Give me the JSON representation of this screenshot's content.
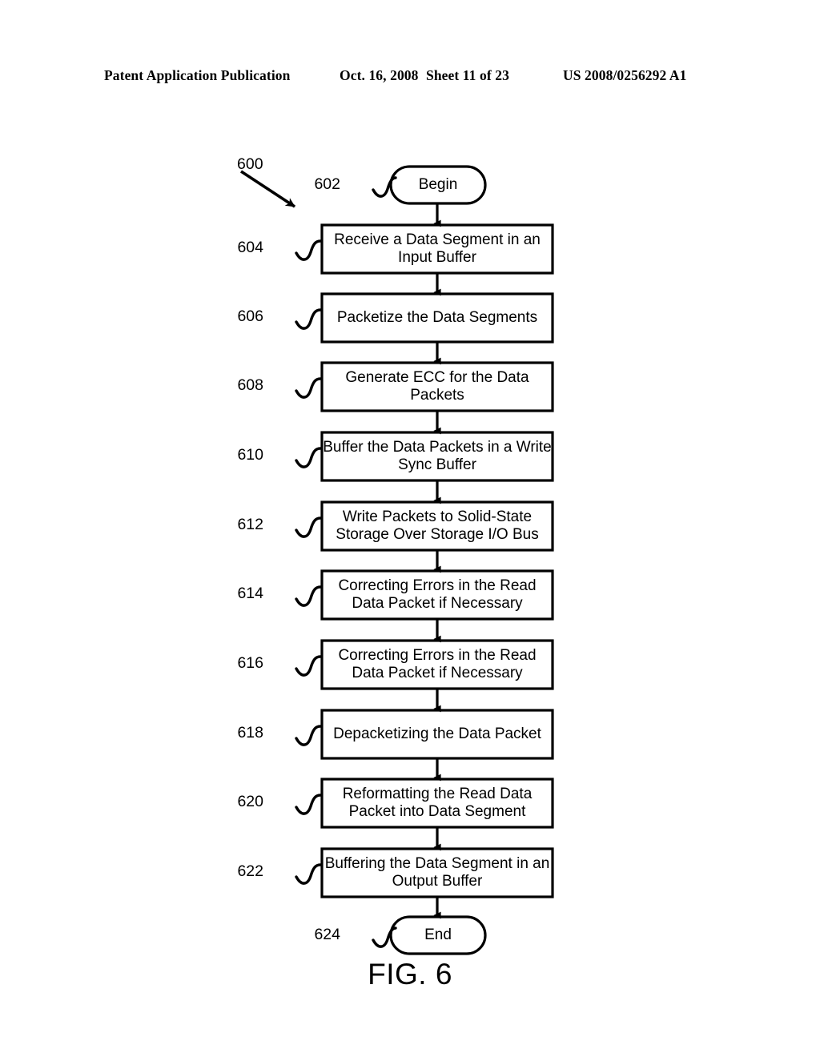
{
  "header": {
    "publication": "Patent Application Publication",
    "date": "Oct. 16, 2008",
    "sheet": "Sheet 11 of 23",
    "patent_number": "US 2008/0256292 A1"
  },
  "figure": {
    "caption": "FIG. 6",
    "diagram_ref": "600",
    "nodes": [
      {
        "ref": "602",
        "label": "Begin",
        "shape": "terminator"
      },
      {
        "ref": "604",
        "label": "Receive a Data Segment in an Input Buffer",
        "shape": "process"
      },
      {
        "ref": "606",
        "label": "Packetize the Data Segments",
        "shape": "process"
      },
      {
        "ref": "608",
        "label": "Generate ECC for the Data Packets",
        "shape": "process"
      },
      {
        "ref": "610",
        "label": "Buffer the Data Packets in a Write Sync Buffer",
        "shape": "process"
      },
      {
        "ref": "612",
        "label": "Write Packets to Solid-State Storage Over Storage I/O Bus",
        "shape": "process"
      },
      {
        "ref": "614",
        "label": "Correcting Errors in the Read Data Packet if Necessary",
        "shape": "process"
      },
      {
        "ref": "616",
        "label": "Correcting Errors in the Read Data Packet if Necessary",
        "shape": "process"
      },
      {
        "ref": "618",
        "label": "Depacketizing the Data Packet",
        "shape": "process"
      },
      {
        "ref": "620",
        "label": "Reformatting the Read Data Packet into Data Segment",
        "shape": "process"
      },
      {
        "ref": "622",
        "label": "Buffering the Data Segment in an Output Buffer",
        "shape": "process"
      },
      {
        "ref": "624",
        "label": "End",
        "shape": "terminator"
      }
    ]
  }
}
